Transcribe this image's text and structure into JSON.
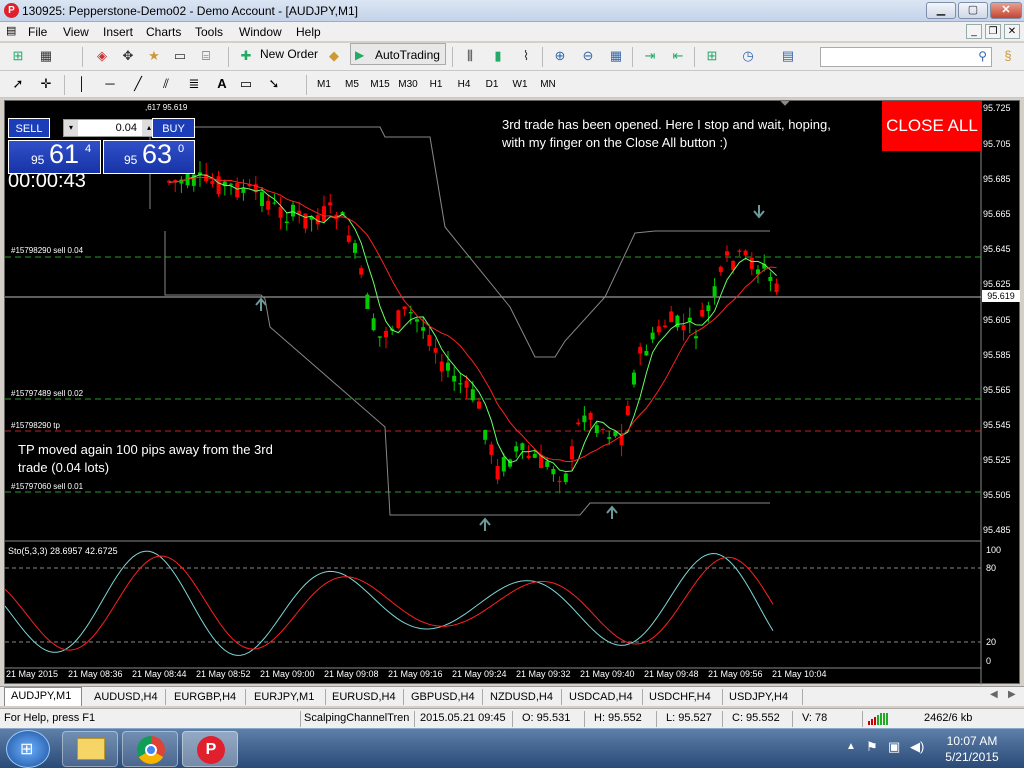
{
  "window": {
    "title": "130925: Pepperstone-Demo02 - Demo Account - [AUDJPY,M1]",
    "app_logo": "P"
  },
  "menu": [
    "File",
    "View",
    "Insert",
    "Charts",
    "Tools",
    "Window",
    "Help"
  ],
  "toolbar": {
    "new_order": "New Order",
    "autotrading": "AutoTrading"
  },
  "timeframes": [
    "M1",
    "M5",
    "M15",
    "M30",
    "H1",
    "H4",
    "D1",
    "W1",
    "MN"
  ],
  "chart": {
    "overlay_info": ",617 95.619",
    "timer": "00:00:43",
    "current_price": "95.619",
    "price_labels": [
      "95.725",
      "95.705",
      "95.685",
      "95.665",
      "95.645",
      "95.625",
      "95.605",
      "95.585",
      "95.565",
      "95.545",
      "95.525",
      "95.505",
      "95.485"
    ],
    "order_lines": [
      {
        "label": "#15798290 sell 0.04"
      },
      {
        "label": "#15797489 sell 0.02"
      },
      {
        "label": "#15798290 tp"
      },
      {
        "label": "#15797060 sell 0.01"
      }
    ],
    "note_top": [
      "3rd trade has been opened. Here I stop and wait, hoping,",
      "with my finger on the Close All button :)"
    ],
    "note_bottom": [
      "TP moved again 100 pips away from the 3rd",
      "trade (0.04 lots)"
    ],
    "close_all": "CLOSE ALL",
    "stoch_label": "Sto(5,3,3) 28.6957 42.6725",
    "stoch_levels": [
      "100",
      "80",
      "20",
      "0"
    ],
    "time_labels": [
      "21 May 2015",
      "21 May 08:36",
      "21 May 08:44",
      "21 May 08:52",
      "21 May 09:00",
      "21 May 09:08",
      "21 May 09:16",
      "21 May 09:24",
      "21 May 09:32",
      "21 May 09:40",
      "21 May 09:48",
      "21 May 09:56",
      "21 May 10:04"
    ]
  },
  "trade_panel": {
    "sell": "SELL",
    "buy": "BUY",
    "lot": "0.04",
    "sell_small": "95",
    "sell_big": "61",
    "sell_pip": "4",
    "buy_small": "95",
    "buy_big": "63",
    "buy_pip": "0"
  },
  "tabs": [
    "AUDJPY,M1",
    "AUDUSD,H4",
    "EURGBP,H4",
    "EURJPY,M1",
    "EURUSD,H4",
    "GBPUSD,H4",
    "NZDUSD,H4",
    "USDCAD,H4",
    "USDCHF,H4",
    "USDJPY,H4"
  ],
  "status": {
    "help": "For Help, press F1",
    "profile": "ScalpingChannelTren",
    "datetime": "2015.05.21 09:45",
    "open": "O: 95.531",
    "high": "H: 95.552",
    "low": "L: 95.527",
    "close": "C: 95.552",
    "volume": "V: 78",
    "traffic": "2462/6 kb"
  },
  "taskbar": {
    "time": "10:07 AM",
    "date": "5/21/2015"
  },
  "colors": {
    "bull": "#00cc00",
    "bear": "#ff0000",
    "ma_fast": "#66ff66",
    "ma_slow": "#ff2020",
    "stoch_main": "#7fd6d6",
    "stoch_signal": "#ff2020"
  }
}
